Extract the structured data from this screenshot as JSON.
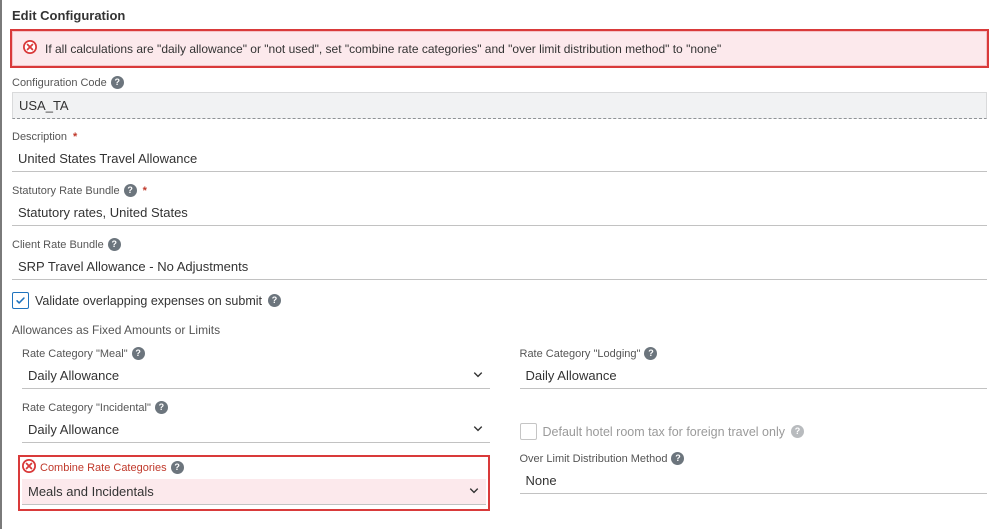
{
  "page_title": "Edit Configuration",
  "error_message": "If all calculations are \"daily allowance\" or \"not used\", set \"combine rate categories\" and \"over limit distribution method\" to \"none\"",
  "config_code": {
    "label": "Configuration Code",
    "value": "USA_TA"
  },
  "description": {
    "label": "Description",
    "value": "United States Travel Allowance"
  },
  "statutory_bundle": {
    "label": "Statutory Rate Bundle",
    "value": "Statutory rates, United States"
  },
  "client_bundle": {
    "label": "Client Rate Bundle",
    "value": "SRP Travel Allowance - No Adjustments"
  },
  "validate_overlap": {
    "label": "Validate overlapping expenses on submit",
    "checked": true
  },
  "section_head": "Allowances as Fixed Amounts or Limits",
  "rate_meal": {
    "label": "Rate Category \"Meal\"",
    "value": "Daily Allowance"
  },
  "rate_lodging": {
    "label": "Rate Category \"Lodging\"",
    "value": "Daily Allowance"
  },
  "rate_incidental": {
    "label": "Rate Category \"Incidental\"",
    "value": "Daily Allowance"
  },
  "default_hotel_tax": {
    "label": "Default hotel room tax for foreign travel only",
    "checked": false
  },
  "combine_rate": {
    "label": "Combine Rate Categories",
    "value": "Meals and Incidentals",
    "has_error": true
  },
  "over_limit": {
    "label": "Over Limit Distribution Method",
    "value": "None"
  }
}
